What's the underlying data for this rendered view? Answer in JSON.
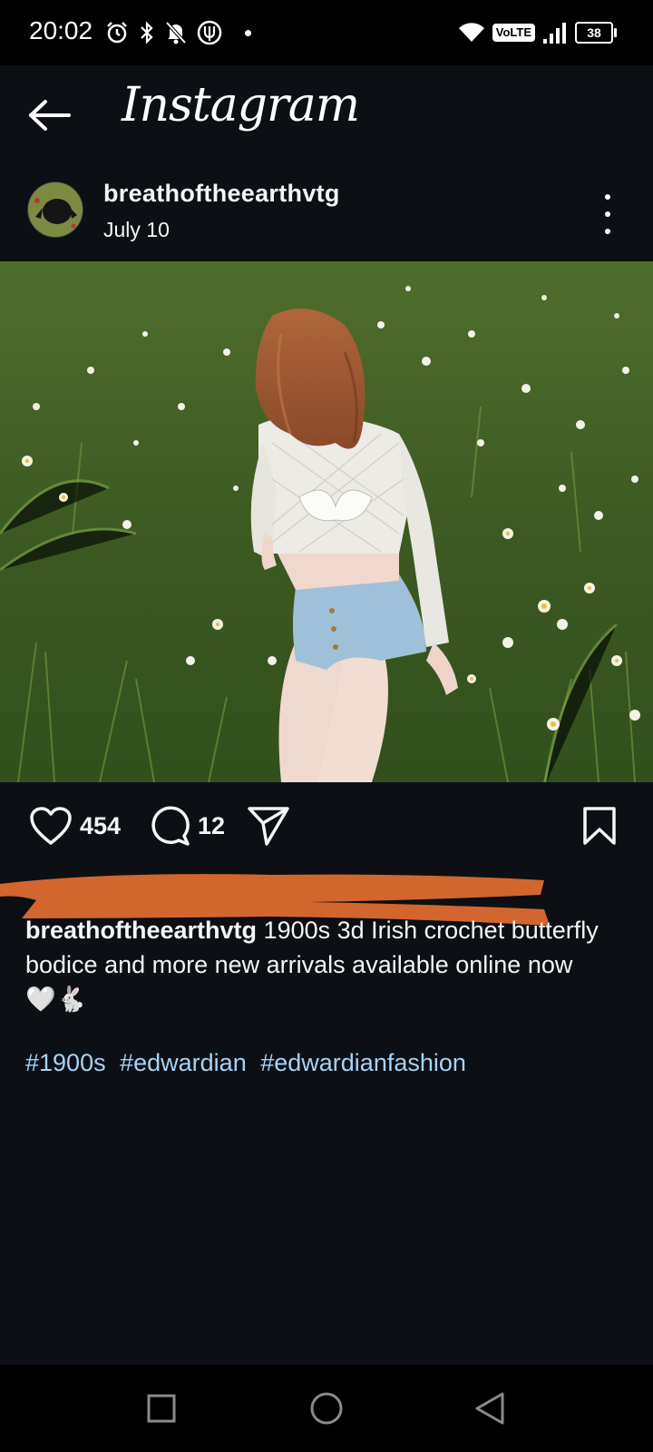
{
  "status_bar": {
    "time": "20:02",
    "network_badge": "VoLTE",
    "battery_level": "38",
    "icons_left": [
      "alarm-icon",
      "bluetooth-icon",
      "notifications-off-icon",
      "data-saver-icon",
      "dot"
    ],
    "icons_right": [
      "wifi-icon",
      "volte-badge",
      "signal-icon",
      "battery-icon"
    ]
  },
  "header": {
    "logo_text": "Instagram",
    "back_icon": "arrow-left-icon"
  },
  "post": {
    "username": "breathoftheearthvtg",
    "date": "July 10",
    "likes_count": "454",
    "comments_count": "12",
    "caption_username": "breathoftheearthvtg",
    "caption_text": "1900s 3d Irish crochet butterfly bodice and more new arrivals available online now 🤍🐇",
    "hashtags": [
      "#1900s",
      "#edwardian",
      "#edwardianfashion"
    ]
  },
  "colors": {
    "background": "#0c1014",
    "text": "#f3f5f7",
    "hashtag": "#a6d2f6",
    "redaction": "#d2662e"
  },
  "nav": {
    "icons": [
      "recents-square-icon",
      "home-circle-icon",
      "back-triangle-icon"
    ]
  }
}
